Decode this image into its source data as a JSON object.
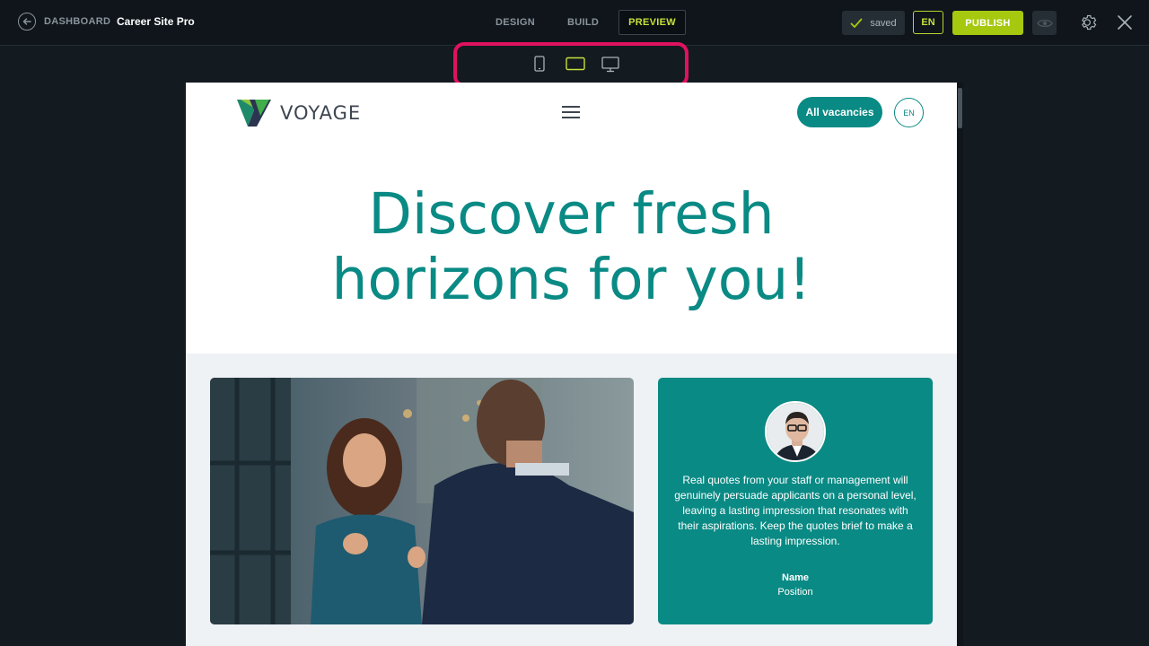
{
  "topbar": {
    "back_label": "DASHBOARD",
    "site_name": "Career Site Pro",
    "tabs": [
      {
        "label": "DESIGN"
      },
      {
        "label": "BUILD"
      },
      {
        "label": "PREVIEW"
      }
    ],
    "active_tab": "PREVIEW",
    "saved_label": "saved",
    "lang_label": "EN",
    "publish_label": "PUBLISH",
    "icons": [
      "arrow-left-icon",
      "check-icon",
      "eye-icon",
      "gear-icon",
      "close-icon"
    ]
  },
  "device_switcher": {
    "devices": [
      "mobile-icon",
      "tablet-icon",
      "desktop-icon"
    ],
    "active_device": "tablet",
    "highlight_color": "#e0125f"
  },
  "preview": {
    "logo_text": "VOYAGE",
    "vacancies_label": "All vacancies",
    "lang_label": "EN",
    "hero_line1": "Discover fresh",
    "hero_line2": "horizons for you!",
    "quote": {
      "text": "Real quotes from your staff or management will genuinely persuade applicants on a personal level, leaving a lasting impression that resonates with their aspirations. Keep the quotes brief to make a lasting impression.",
      "name": "Name",
      "position": "Position"
    }
  },
  "colors": {
    "brand_teal": "#0a8a84",
    "accent_lime": "#a6c80f",
    "annotation_pink": "#e0125f",
    "topbar_bg": "#0f151b"
  }
}
